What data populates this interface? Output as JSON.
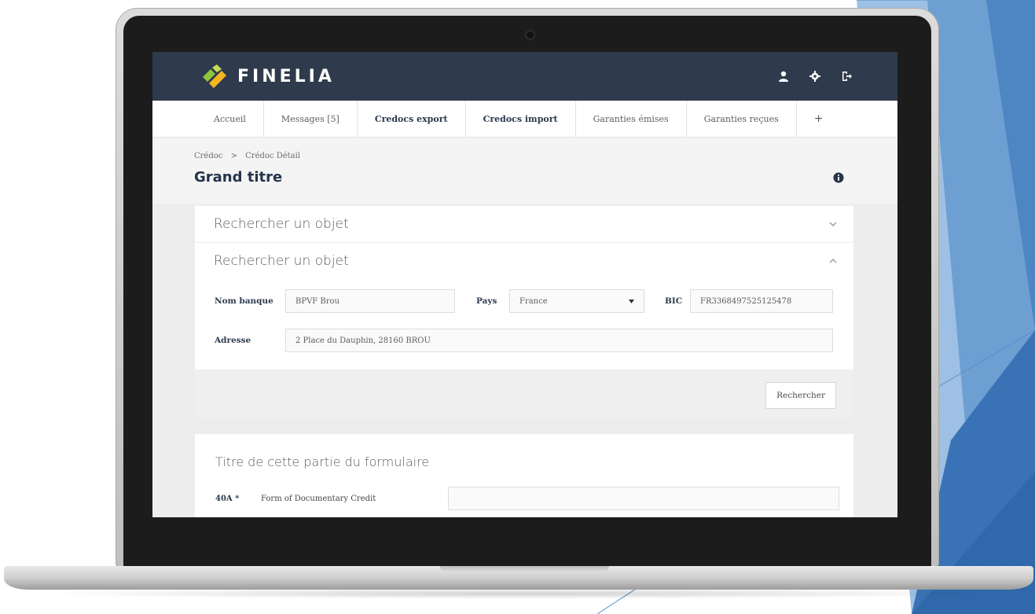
{
  "app": {
    "brand": "FINELIA",
    "brand_color": "#2f3b4c",
    "logo_colors": [
      "#8fc63f",
      "#f4b51f"
    ],
    "icons": [
      "user-icon",
      "gear-icon",
      "logout-icon"
    ]
  },
  "nav": {
    "items": [
      {
        "label": "Accueil"
      },
      {
        "label": "Messages [5]"
      },
      {
        "label": "Credocs export"
      },
      {
        "label": "Credocs import"
      },
      {
        "label": "Garanties émises"
      },
      {
        "label": "Garanties reçues"
      },
      {
        "label": "+"
      }
    ]
  },
  "breadcrumb": {
    "items": [
      "Crédoc",
      "Crédoc Détail"
    ],
    "separator": ">"
  },
  "page": {
    "title": "Grand titre"
  },
  "search_panel": {
    "collapsed_title": "Rechercher un objet",
    "open_title": "Rechercher un objet",
    "fields": {
      "bank_label": "Nom banque",
      "bank_value": "BPVF Brou",
      "country_label": "Pays",
      "country_value": "France",
      "bic_label": "BIC",
      "bic_value": "FR3368497525125478",
      "address_label": "Adresse",
      "address_value": "2 Place du Dauphin, 28160 BROU"
    },
    "search_button": "Rechercher"
  },
  "form_section": {
    "title": "Titre de cette partie du formulaire",
    "rows": [
      {
        "code": "40A *",
        "label": "Form of Documentary Credit",
        "value": ""
      }
    ]
  }
}
